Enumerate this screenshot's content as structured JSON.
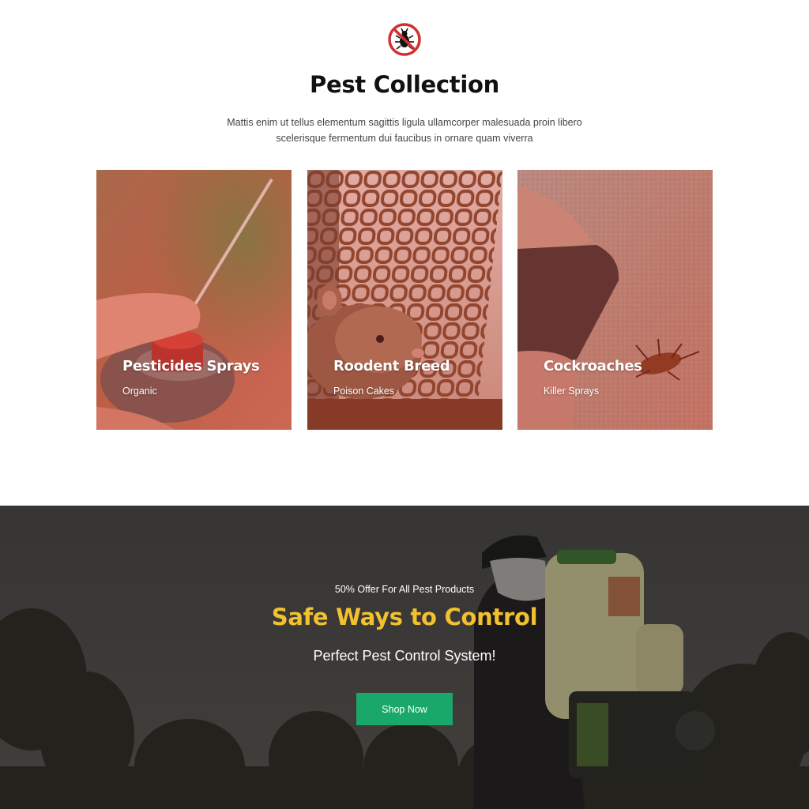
{
  "header": {
    "logo_icon": "no-bugs-icon",
    "title": "Pest Collection",
    "description": "Mattis enim ut tellus elementum sagittis ligula ullamcorper malesuada proin libero scelerisque fermentum dui faucibus in ornare quam viverra"
  },
  "cards": [
    {
      "title": "Pesticides Sprays",
      "subtitle": "Organic",
      "image": "spray-can-photo"
    },
    {
      "title": "Roodent Breed",
      "subtitle": "Poison Cakes",
      "image": "rat-in-cage-photo"
    },
    {
      "title": "Cockroaches",
      "subtitle": "Killer Sprays",
      "image": "cockroach-photo"
    }
  ],
  "promo": {
    "offer": "50% Offer For All Pest Products",
    "headline": "Safe Ways to Control",
    "tagline": "Perfect Pest Control System!",
    "button_label": "Shop Now",
    "background_image": "sprayer-worker-photo"
  },
  "colors": {
    "headline_accent": "#f2c12e",
    "button": "#1aa76a",
    "logo_red": "#d32f2f",
    "card_overlay": "#d23c32"
  }
}
